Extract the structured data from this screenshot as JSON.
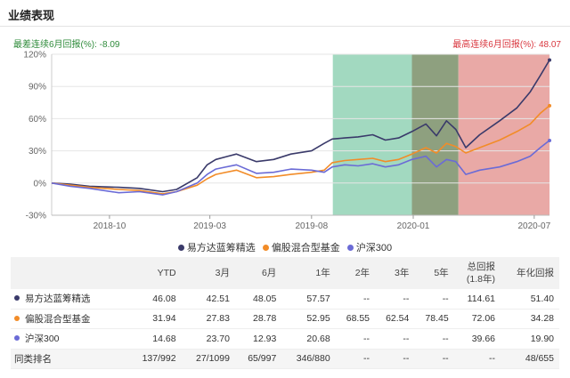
{
  "header": {
    "title": "业绩表现"
  },
  "extremes": {
    "worst_label": "最差连续6月回报(%): ",
    "worst_value": "-8.09",
    "best_label": "最高连续6月回报(%): ",
    "best_value": "48.07"
  },
  "chart_data": {
    "type": "line",
    "ylim": [
      -30,
      120
    ],
    "yticks": [
      -30,
      0,
      30,
      60,
      90,
      120
    ],
    "ytick_labels": [
      "-30%",
      "0%",
      "30%",
      "60%",
      "90%",
      "120%"
    ],
    "xlim": [
      "2018-07-06",
      "2020-07-24"
    ],
    "xticks": [
      "2018-10",
      "2019-03",
      "2019-08",
      "2020-01",
      "2020-07"
    ],
    "grid": true,
    "legend_position": "bottom",
    "shaded_regions": [
      {
        "from": "2019-09-02",
        "to": "2019-12-30",
        "color": "#a2d9c0"
      },
      {
        "from": "2019-12-30",
        "to": "2020-03-09",
        "color": "#8ea07f"
      },
      {
        "from": "2020-03-09",
        "to": "2020-07-24",
        "color": "#e9a9a6"
      }
    ],
    "series": [
      {
        "name": "易方达蓝筹精选",
        "color": "#3a3a6a",
        "points": [
          [
            "2018-07-06",
            0
          ],
          [
            "2018-08-03",
            -1
          ],
          [
            "2018-09-01",
            -3
          ],
          [
            "2018-10-15",
            -4
          ],
          [
            "2018-11-15",
            -5
          ],
          [
            "2018-12-20",
            -8
          ],
          [
            "2019-01-10",
            -6
          ],
          [
            "2019-02-10",
            5
          ],
          [
            "2019-02-25",
            17
          ],
          [
            "2019-03-10",
            22
          ],
          [
            "2019-04-10",
            27
          ],
          [
            "2019-05-10",
            20
          ],
          [
            "2019-06-05",
            22
          ],
          [
            "2019-07-01",
            27
          ],
          [
            "2019-08-01",
            30
          ],
          [
            "2019-08-20",
            37
          ],
          [
            "2019-09-01",
            41
          ],
          [
            "2019-09-20",
            42
          ],
          [
            "2019-10-10",
            43
          ],
          [
            "2019-11-01",
            45
          ],
          [
            "2019-11-20",
            40
          ],
          [
            "2019-12-10",
            42
          ],
          [
            "2019-12-30",
            48
          ],
          [
            "2020-01-20",
            55
          ],
          [
            "2020-02-05",
            44
          ],
          [
            "2020-02-20",
            58
          ],
          [
            "2020-03-05",
            50
          ],
          [
            "2020-03-20",
            33
          ],
          [
            "2020-04-10",
            45
          ],
          [
            "2020-05-10",
            58
          ],
          [
            "2020-06-05",
            70
          ],
          [
            "2020-06-25",
            85
          ],
          [
            "2020-07-10",
            100
          ],
          [
            "2020-07-24",
            114.61
          ]
        ]
      },
      {
        "name": "偏股混合型基金",
        "color": "#f28c28",
        "points": [
          [
            "2018-07-06",
            0
          ],
          [
            "2018-08-03",
            -2
          ],
          [
            "2018-09-01",
            -4
          ],
          [
            "2018-10-15",
            -6
          ],
          [
            "2018-11-15",
            -7
          ],
          [
            "2018-12-20",
            -10
          ],
          [
            "2019-01-10",
            -8
          ],
          [
            "2019-02-10",
            -2
          ],
          [
            "2019-02-25",
            4
          ],
          [
            "2019-03-10",
            8
          ],
          [
            "2019-04-10",
            12
          ],
          [
            "2019-05-10",
            5
          ],
          [
            "2019-06-05",
            6
          ],
          [
            "2019-07-01",
            8
          ],
          [
            "2019-08-01",
            10
          ],
          [
            "2019-08-20",
            12
          ],
          [
            "2019-09-01",
            19
          ],
          [
            "2019-09-20",
            21
          ],
          [
            "2019-10-10",
            22
          ],
          [
            "2019-11-01",
            23
          ],
          [
            "2019-11-20",
            20
          ],
          [
            "2019-12-10",
            22
          ],
          [
            "2019-12-30",
            27
          ],
          [
            "2020-01-20",
            33
          ],
          [
            "2020-02-05",
            28
          ],
          [
            "2020-02-20",
            37
          ],
          [
            "2020-03-05",
            34
          ],
          [
            "2020-03-20",
            28
          ],
          [
            "2020-04-10",
            33
          ],
          [
            "2020-05-10",
            40
          ],
          [
            "2020-06-05",
            48
          ],
          [
            "2020-06-25",
            55
          ],
          [
            "2020-07-10",
            65
          ],
          [
            "2020-07-24",
            72.06
          ]
        ]
      },
      {
        "name": "沪深300",
        "color": "#6b6bd6",
        "points": [
          [
            "2018-07-06",
            0
          ],
          [
            "2018-08-03",
            -3
          ],
          [
            "2018-09-01",
            -5
          ],
          [
            "2018-10-15",
            -9
          ],
          [
            "2018-11-15",
            -8
          ],
          [
            "2018-12-20",
            -11
          ],
          [
            "2019-01-10",
            -8
          ],
          [
            "2019-02-10",
            0
          ],
          [
            "2019-02-25",
            8
          ],
          [
            "2019-03-10",
            13
          ],
          [
            "2019-04-10",
            17
          ],
          [
            "2019-05-10",
            9
          ],
          [
            "2019-06-05",
            10
          ],
          [
            "2019-07-01",
            13
          ],
          [
            "2019-08-01",
            12
          ],
          [
            "2019-08-20",
            10
          ],
          [
            "2019-09-01",
            15
          ],
          [
            "2019-09-20",
            17
          ],
          [
            "2019-10-10",
            16
          ],
          [
            "2019-11-01",
            18
          ],
          [
            "2019-11-20",
            15
          ],
          [
            "2019-12-10",
            17
          ],
          [
            "2019-12-30",
            22
          ],
          [
            "2020-01-20",
            25
          ],
          [
            "2020-02-05",
            15
          ],
          [
            "2020-02-20",
            22
          ],
          [
            "2020-03-05",
            20
          ],
          [
            "2020-03-20",
            8
          ],
          [
            "2020-04-10",
            12
          ],
          [
            "2020-05-10",
            15
          ],
          [
            "2020-06-05",
            20
          ],
          [
            "2020-06-25",
            25
          ],
          [
            "2020-07-10",
            33
          ],
          [
            "2020-07-24",
            39.66
          ]
        ]
      }
    ]
  },
  "table": {
    "headers": [
      "",
      "YTD",
      "3月",
      "6月",
      "1年",
      "2年",
      "3年",
      "5年",
      "总回报",
      "年化回报"
    ],
    "total_return_sub": "(1.8年)",
    "rows": [
      {
        "name": "易方达蓝筹精选",
        "color": "#3a3a6a",
        "cells": [
          "46.08",
          "42.51",
          "48.05",
          "57.57",
          "--",
          "--",
          "--",
          "114.61",
          "51.40"
        ]
      },
      {
        "name": "偏股混合型基金",
        "color": "#f28c28",
        "cells": [
          "31.94",
          "27.83",
          "28.78",
          "52.95",
          "68.55",
          "62.54",
          "78.45",
          "72.06",
          "34.28"
        ]
      },
      {
        "name": "沪深300",
        "color": "#6b6bd6",
        "cells": [
          "14.68",
          "23.70",
          "12.93",
          "20.68",
          "--",
          "--",
          "--",
          "39.66",
          "19.90"
        ]
      },
      {
        "name": "同类排名",
        "color": "",
        "cells": [
          "137/992",
          "27/1099",
          "65/997",
          "346/880",
          "--",
          "--",
          "--",
          "--",
          "48/655"
        ]
      }
    ]
  }
}
